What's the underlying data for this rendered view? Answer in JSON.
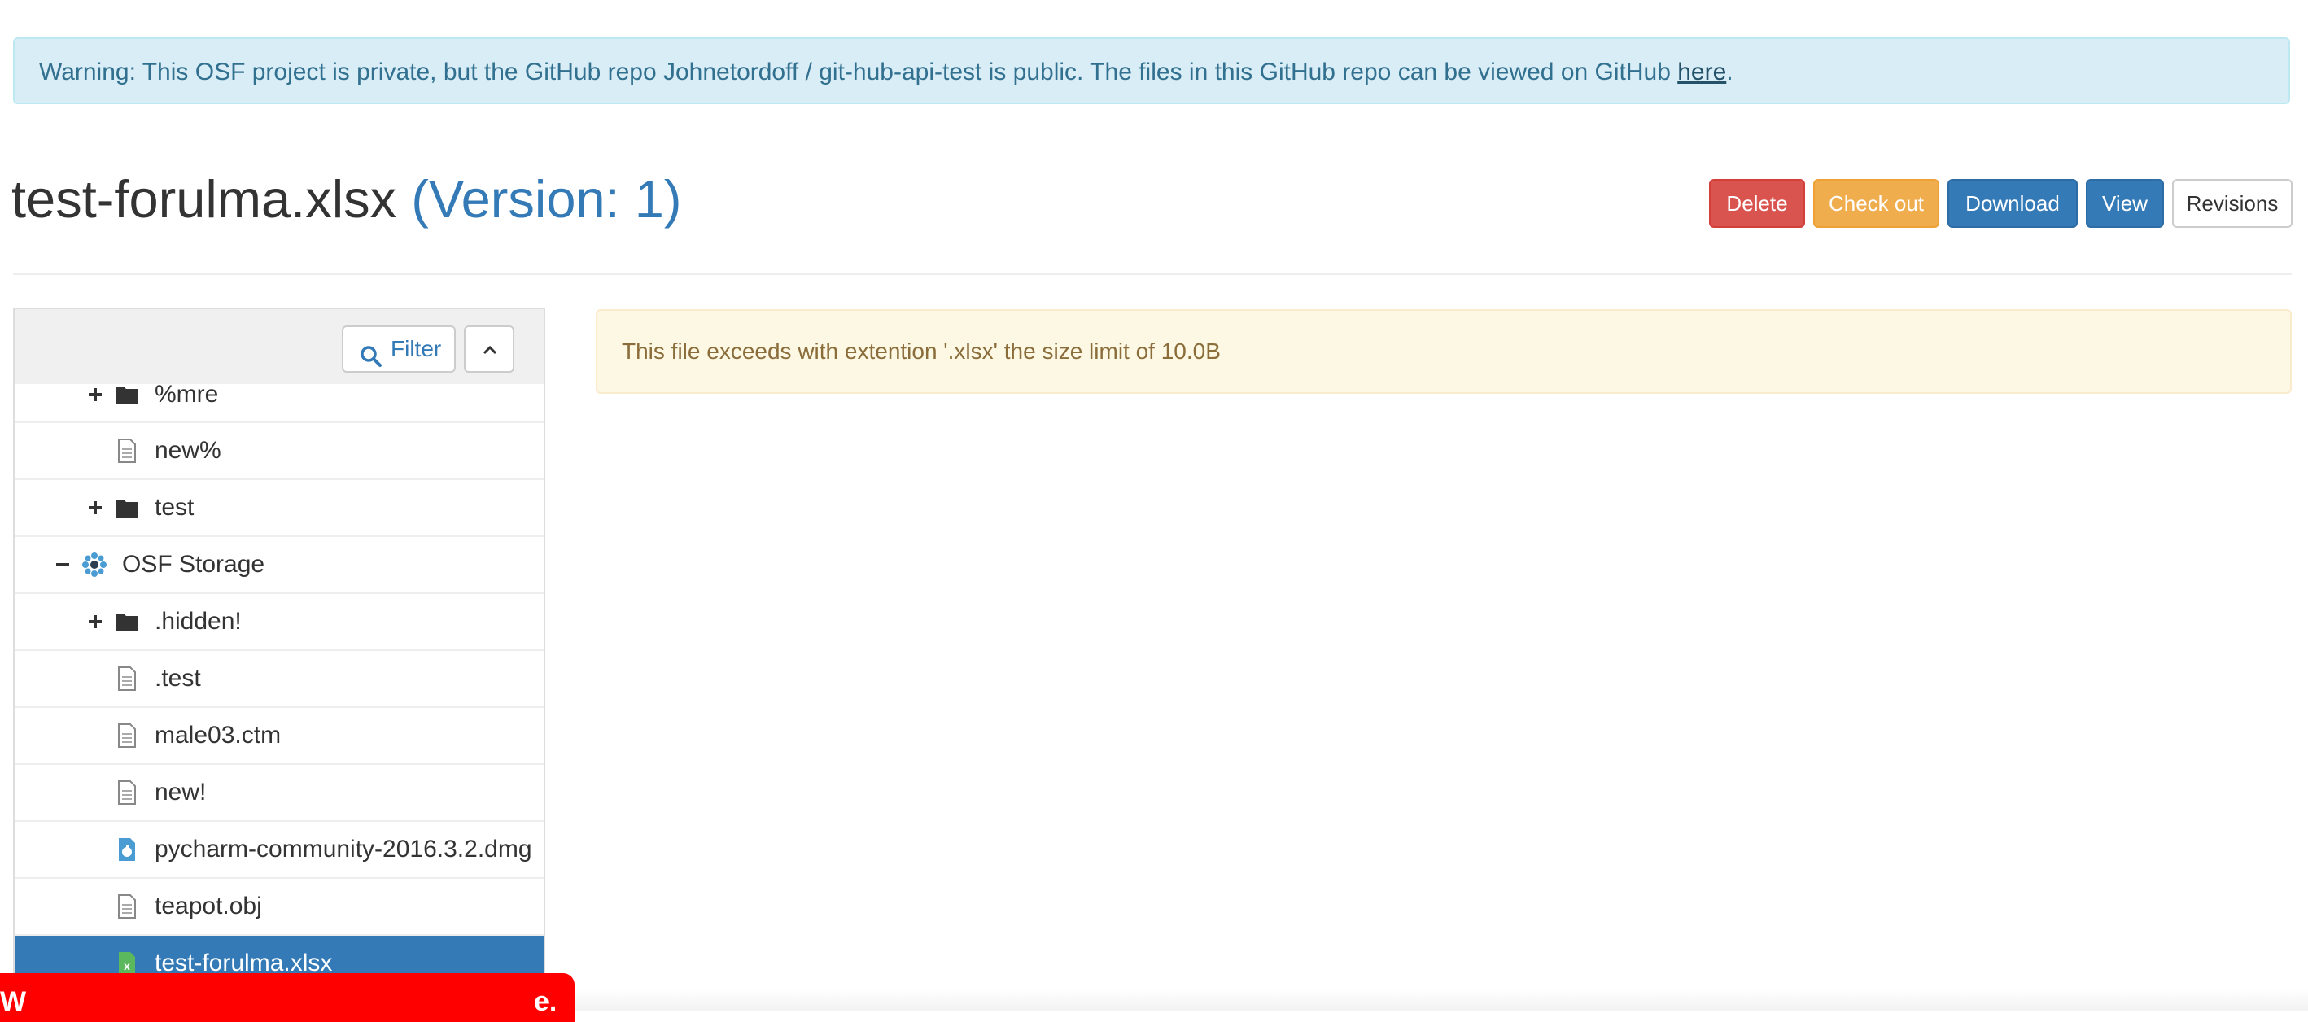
{
  "warning": {
    "text": "Warning: This OSF project is private, but the GitHub repo Johnetordoff / git-hub-api-test is public. The files in this GitHub repo can be viewed on GitHub ",
    "link": "here",
    "end": "."
  },
  "file": {
    "name": "test-forulma.xlsx",
    "version": "(Version: 1)"
  },
  "actions": {
    "delete": "Delete",
    "checkout": "Check out",
    "download": "Download",
    "view": "View",
    "revisions": "Revisions"
  },
  "tree": {
    "filter_label": "Filter",
    "items": [
      {
        "label": "%mre",
        "type": "folder",
        "toggle": "+"
      },
      {
        "label": "new%",
        "type": "file"
      },
      {
        "label": "test",
        "type": "folder",
        "toggle": "+"
      },
      {
        "label": "OSF Storage",
        "type": "provider",
        "toggle": "−"
      },
      {
        "label": ".hidden!",
        "type": "folder",
        "toggle": "+"
      },
      {
        "label": ".test",
        "type": "file"
      },
      {
        "label": "male03.ctm",
        "type": "file"
      },
      {
        "label": "new!",
        "type": "file"
      },
      {
        "label": "pycharm-community-2016.3.2.dmg",
        "type": "dmg"
      },
      {
        "label": "teapot.obj",
        "type": "file"
      },
      {
        "label": "test-forulma.xlsx",
        "type": "xlsx",
        "selected": true
      }
    ]
  },
  "alert": {
    "text": "This file exceeds with extention '.xlsx' the size limit of 10.0B"
  },
  "toast": {
    "left": "W",
    "right": "e."
  },
  "colors": {
    "primary": "#337ab7",
    "danger": "#d9534f",
    "warning": "#f0ad4e",
    "info_bg": "#d9edf7",
    "alert_bg": "#fcf8e3"
  }
}
